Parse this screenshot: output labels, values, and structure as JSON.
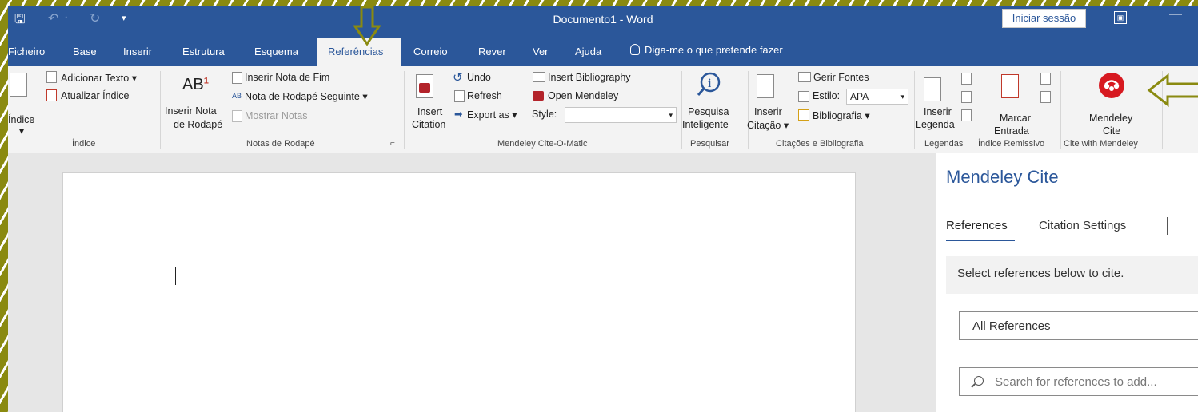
{
  "window": {
    "title": "Documento1  -  Word",
    "signin_label": "Iniciar sessão",
    "quick_access": {
      "save": "🖫",
      "undo": "↶",
      "undo_menu": "·",
      "redo": "↻",
      "customize": "▾"
    },
    "ribbon_display": "▣",
    "minimize": "—"
  },
  "tabs": [
    "Ficheiro",
    "Base",
    "Inserir",
    "Estrutura",
    "Esquema",
    "Referências",
    "Correio",
    "Rever",
    "Ver",
    "Ajuda"
  ],
  "tell_me": "Diga-me o que pretende fazer",
  "ribbon": {
    "indice": {
      "big": "Índice",
      "dropdown": "▾",
      "add_text": "Adicionar Texto ▾",
      "update": "Atualizar Índice",
      "group": "Índice"
    },
    "footnotes": {
      "ab_glyph": "AB",
      "sup": "1",
      "insert_line1": "Inserir Nota",
      "insert_line2": "de Rodapé",
      "endnote": "Inserir Nota de Fim",
      "next": "Nota de Rodapé Seguinte  ▾",
      "show": "Mostrar Notas",
      "group": "Notas de Rodapé",
      "launcher": "⌐"
    },
    "mendeley_cite_o_matic": {
      "insert_line1": "Insert",
      "insert_line2": "Citation",
      "undo": "Undo",
      "refresh": "Refresh",
      "export": "Export as ▾",
      "bibliography": "Insert Bibliography",
      "open": "Open Mendeley",
      "style_label": "Style:",
      "style_value": "",
      "group": "Mendeley Cite-O-Matic"
    },
    "search": {
      "line1": "Pesquisa",
      "line2": "Inteligente",
      "group": "Pesquisar"
    },
    "citations": {
      "insert_line1": "Inserir",
      "insert_line2": "Citação ▾",
      "manage": "Gerir Fontes",
      "style_label": "Estilo:",
      "style_value": "APA",
      "bibliography": "Bibliografia ▾",
      "group": "Citações e Bibliografia"
    },
    "captions": {
      "line1": "Inserir",
      "line2": "Legenda",
      "group": "Legendas"
    },
    "index": {
      "line1": "Marcar",
      "line2": "Entrada",
      "group": "Índice Remissivo"
    },
    "cite_with_mendeley": {
      "line1": "Mendeley",
      "line2": "Cite",
      "group": "Cite with Mendeley"
    }
  },
  "pane": {
    "title": "Mendeley Cite",
    "tabs": [
      "References",
      "Citation Settings"
    ],
    "info": "Select references below to cite.",
    "filter": "All References",
    "search_placeholder": "Search for references to add..."
  },
  "colors": {
    "word_blue": "#2b579a",
    "annotation_arrow": "#8a8a10",
    "mendeley_red": "#d71920"
  }
}
